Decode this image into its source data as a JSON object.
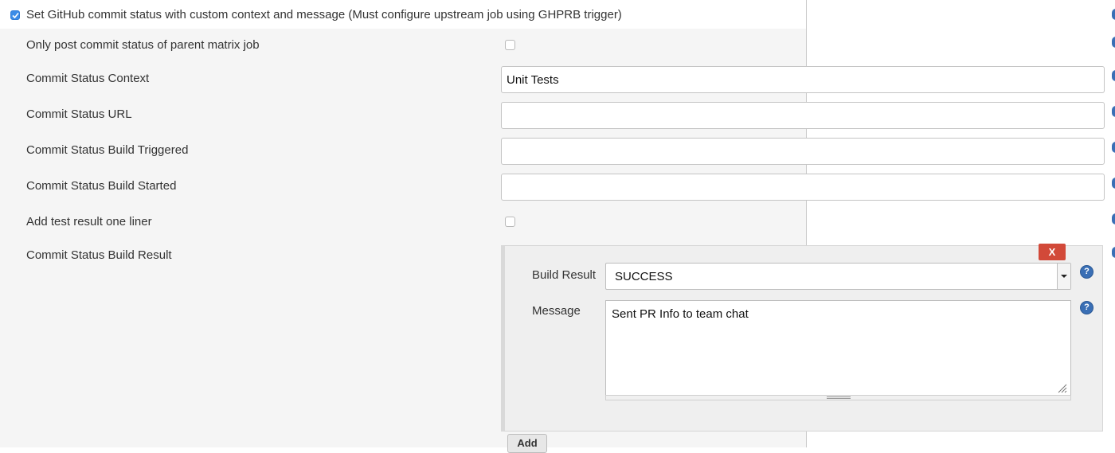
{
  "header": {
    "checked": true,
    "label": "Set GitHub commit status with custom context and message (Must configure upstream job using GHPRB trigger)"
  },
  "fields": {
    "only_parent_label": "Only post commit status of parent matrix job",
    "context_label": "Commit Status Context",
    "context_value": "Unit Tests",
    "url_label": "Commit Status URL",
    "url_value": "",
    "triggered_label": "Commit Status Build Triggered",
    "triggered_value": "",
    "started_label": "Commit Status Build Started",
    "started_value": "",
    "one_liner_label": "Add test result one liner",
    "build_result_label": "Commit Status Build Result"
  },
  "result_block": {
    "delete_label": "X",
    "build_result_label": "Build Result",
    "build_result_value": "SUCCESS",
    "message_label": "Message",
    "message_value": "Sent PR Info to team chat",
    "help_glyph": "?",
    "add_label": "Add"
  },
  "icons": {
    "help": "help-icon",
    "check": "check-icon",
    "dropdown": "chevron-down-icon"
  },
  "colors": {
    "accent_blue": "#3c8ce7",
    "delete_red": "#d24939",
    "help_blue": "#3a6fb5"
  }
}
